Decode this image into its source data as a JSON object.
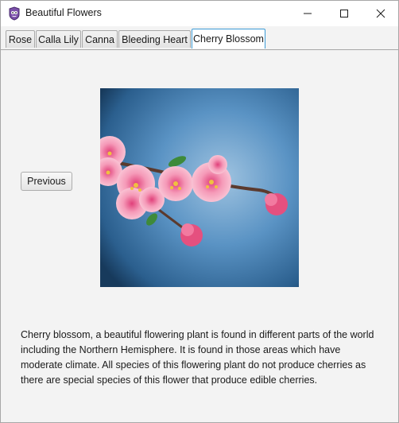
{
  "window": {
    "title": "Beautiful Flowers",
    "icon": "app-icon",
    "controls": [
      "minimize-icon",
      "maximize-icon",
      "close-icon"
    ]
  },
  "tabs": [
    {
      "label": "Rose",
      "selected": false
    },
    {
      "label": "Calla Lily",
      "selected": false
    },
    {
      "label": "Canna",
      "selected": false
    },
    {
      "label": "Bleeding Heart",
      "selected": false
    },
    {
      "label": "Cherry Blossom",
      "selected": true
    }
  ],
  "main": {
    "previous_label": "Previous",
    "image_subject": "cherry blossom branch",
    "description": "Cherry blossom, a beautiful flowering plant is found in different parts of the world including the Northern Hemisphere. It is found in those areas which have moderate climate. All species of this flowering plant do not produce cherries as there are special species of this flower that produce edible cherries."
  },
  "colors": {
    "tab_selected_border": "#3c9bd6",
    "window_bg": "#f3f3f3",
    "text": "#1a1a1a"
  }
}
